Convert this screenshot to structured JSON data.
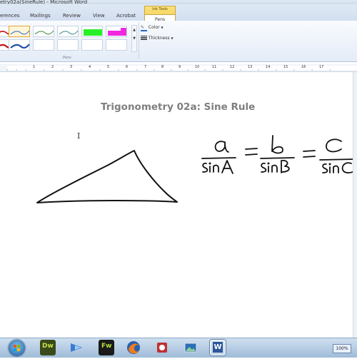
{
  "window": {
    "title": "etry02a(SineRule) - Microsoft Word"
  },
  "ribbon": {
    "tabs": [
      "erences",
      "Mailings",
      "Review",
      "View",
      "Acrobat"
    ],
    "context_header": "Ink Tools",
    "context_tab": "Pens",
    "pens_group_label": "Pens",
    "color_label": "Color",
    "thickness_label": "Thickness"
  },
  "ruler": {
    "numbers": [
      "1",
      "2",
      "3",
      "4",
      "5",
      "6",
      "7",
      "8",
      "9",
      "10",
      "11",
      "12",
      "13",
      "14",
      "15",
      "16",
      "17"
    ]
  },
  "document": {
    "heading": "Trigonometry 02a: Sine Rule"
  },
  "taskbar": {
    "word_badge": "W",
    "dw_badge": "Dw",
    "fw_badge": "Fw",
    "zoom_badge": "100%"
  }
}
